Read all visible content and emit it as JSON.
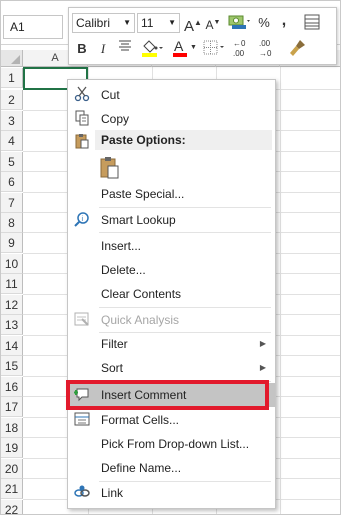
{
  "namebox": {
    "value": "A1"
  },
  "grid": {
    "column_header": "A",
    "rows": [
      "1",
      "2",
      "3",
      "4",
      "5",
      "6",
      "7",
      "8",
      "9",
      "10",
      "11",
      "12",
      "13",
      "14",
      "15",
      "16",
      "17",
      "18",
      "19",
      "20",
      "21",
      "22"
    ]
  },
  "mini_toolbar": {
    "font_name": "Calibri",
    "font_size": "11",
    "buttons": {
      "grow_font": "A",
      "shrink_font": "A",
      "percent": "%",
      "comma": ",",
      "bold": "B",
      "italic": "I",
      "font_color": "A"
    }
  },
  "context_menu": {
    "items": {
      "cut": "Cut",
      "copy": "Copy",
      "paste_options": "Paste Options:",
      "paste_special": "Paste Special...",
      "smart_lookup": "Smart Lookup",
      "insert": "Insert...",
      "delete": "Delete...",
      "clear_contents": "Clear Contents",
      "quick_analysis": "Quick Analysis",
      "filter": "Filter",
      "sort": "Sort",
      "insert_comment": "Insert Comment",
      "format_cells": "Format Cells...",
      "pick_from_list": "Pick From Drop-down List...",
      "define_name": "Define Name...",
      "link": "Link"
    }
  },
  "colors": {
    "excel_green": "#217346",
    "highlight_red": "#e21a2c",
    "selected_item_bg": "#c4c4c4"
  }
}
